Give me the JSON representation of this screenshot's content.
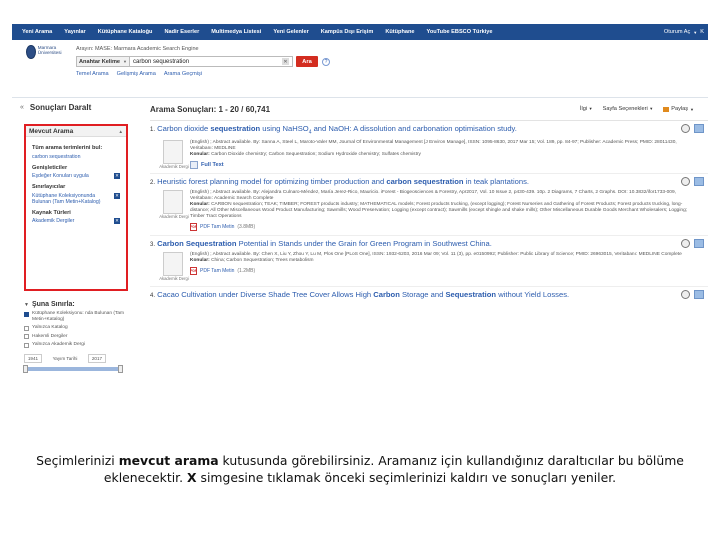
{
  "topnav": {
    "items": [
      "Yeni Arama",
      "Yayınlar",
      "Kütüphane Kataloğu",
      "Nadir Eserler",
      "Multimedya Listesi",
      "Yeni Gelenler",
      "Kampüs Dışı Erişim",
      "Kütüphane",
      "YouTube EBSCO Türkiye"
    ],
    "account": "Oturum Aç",
    "folder": "K"
  },
  "header": {
    "logo_text": "Marmara Üniversitesi",
    "db_line": "Arayın: MASE: Marmara Academic Search Engine",
    "field_select": "Anahtar Kelime",
    "search_value": "carbon sequestration",
    "search_button": "Ara",
    "help": "?",
    "links": [
      "Temel Arama",
      "Gelişmiş Arama",
      "Arama Geçmişi"
    ]
  },
  "left": {
    "collapse": "«",
    "title": "Sonuçları Daralt",
    "current_box_title": "Mevcut Arama",
    "sections": [
      {
        "heading": "Tüm arama terimlerini bul:",
        "items": [
          {
            "label": "carbon sequestration",
            "removable": false
          }
        ]
      },
      {
        "heading": "Genişleticiler",
        "items": [
          {
            "label": "Eşdeğer Konuları uygula",
            "removable": true
          }
        ]
      },
      {
        "heading": "Sınırlayıcılar",
        "items": [
          {
            "label": "Kütüphane Koleksiyonunda Bulunan (Tam Metin+Katalog)",
            "removable": true
          }
        ]
      },
      {
        "heading": "Kaynak Türleri",
        "items": [
          {
            "label": "Akademik Dergiler",
            "removable": true
          }
        ]
      }
    ],
    "limit": {
      "title": "Şuna Sınırla:",
      "toggle": "▼",
      "options": [
        {
          "label": "Kütüphane Koleksiyonu: nda Bulunan (Tam Metin+Katalog)",
          "checked": true
        },
        {
          "label": "Yalnızca Katalog",
          "checked": false
        },
        {
          "label": "Hakemli Dergiler",
          "checked": false
        },
        {
          "label": "Yalnızca Akademik Dergi",
          "checked": false
        }
      ],
      "date_from": "1941",
      "date_label": "Yayım Tarihi",
      "date_to": "2017"
    }
  },
  "results": {
    "heading": "Arama Sonuçları: 1 - 20 / 60,741",
    "tools": [
      "İlgi",
      "Sayfa Seçenekleri",
      "Paylaş"
    ],
    "items": [
      {
        "num": "1.",
        "title_pre": "Carbon dioxide ",
        "title_bold": "sequestration",
        "title_post": " using NaHSO",
        "title_sub": "4",
        "title_end": " and NaOH: A dissolution and carbonation optimisation study.",
        "meta": "(English) ; Abstract available. By: Sanna A, Steel L, Maroto-Valer MM, Journal Of Environmental Management [J Environ Manage], ISSN: 1095-8630, 2017 Mar 15; Vol. 189, pp. 84-97; Publisher: Academic Press; PMID: 28011430, Veritabanı: MEDLINE",
        "subject_label": "Konular:",
        "subjects": "Carbon Dioxide chemistry; Carbon Sequestration; Sodium Hydroxide chemistry; Sulfates chemistry",
        "thumb_label": "Akademik Dergi",
        "link": "Full Text",
        "link_type": "fulltext",
        "size": ""
      },
      {
        "num": "2.",
        "title_pre": "Heuristic forest planning model for optimizing timber production and ",
        "title_bold": "carbon sequestration",
        "title_post": " in teak plantations.",
        "title_sub": "",
        "title_end": "",
        "meta": "(English) ; Abstract available. By: Alejandra Culnaro-Méndez, María Jerez-Rico, Mauricio. iForest - Biogeosciences & Forestry, Apr2017, Vol. 10 Issue 2, p430-439. 10p. 2 Diagrams, 7 Charts, 2 Graphs. DOI: 10.3832/ifor1733-009, Veritabanı: Academic Search Complete",
        "subject_label": "Konular:",
        "subjects": "CARBON sequestration; TEAK; TIMBER; FOREST products industry; MATHEMATICAL models; Forest products trucking, (except logging); Forest Nurseries and Gathering of Forest Products; Forest products trucking, long-distance; All Other Miscellaneous Wood Product Manufacturing; Sawmills; Wood Preservation; Logging (except contract); Sawmills (except shingle and shake mills); Other Miscellaneous Durable Goods Merchant Wholesalers; Logging; Timber Tract Operations",
        "thumb_label": "Akademik Dergi",
        "link": "PDF Tam Metin",
        "link_type": "pdf",
        "size": "(3.8MB)"
      },
      {
        "num": "3.",
        "title_pre": "",
        "title_bold": "Carbon Sequestration",
        "title_post": " Potential in Stands under the Grain for Green Program in Southwest China.",
        "title_sub": "",
        "title_end": "",
        "meta": "(English) ; Abstract available. By: Chen X, Liu Y, Zhou Y, Lu M, Plos One [PLoS One], ISSN: 1932-6203, 2016 Mar 09; Vol. 11 (3), pp. e0150992; Publisher: Public Library of Science; PMID: 26963015, Veritabanı: MEDLINE Complete",
        "subject_label": "Konular:",
        "subjects": "China; Carbon Sequestration; Trees metabolism",
        "thumb_label": "Akademik Dergi",
        "link": "PDF Tam Metin",
        "link_type": "pdf",
        "size": "(1.2MB)"
      },
      {
        "num": "4.",
        "title_pre": "Cacao Cultivation under Diverse Shade Tree Cover Allows High ",
        "title_bold": "Carbon",
        "title_post": " Storage and ",
        "title_sub": "",
        "title_end": "",
        "title_bold2": "Sequestration",
        "title_tail": " without Yield Losses.",
        "meta": "",
        "subject_label": "",
        "subjects": "",
        "thumb_label": "",
        "link": "",
        "link_type": "none",
        "size": ""
      }
    ]
  },
  "caption": {
    "line1_pre": "Seçimlerinizi ",
    "line1_bold": "mevcut arama",
    "line1_post": " kutusunda görebilirsiniz. Aramanız için kullandığınız daraltıcılar bu bölüme",
    "line2_pre": "eklenecektir. ",
    "line2_bold": "X",
    "line2_post": " simgesine tıklamak önceki seçimlerinizi kaldırı ve sonuçları yeniler."
  },
  "colors": {
    "nav_bg": "#1f4d8f",
    "link": "#2d5dae",
    "highlight_box": "#e01e22",
    "search_button": "#d32d20"
  }
}
